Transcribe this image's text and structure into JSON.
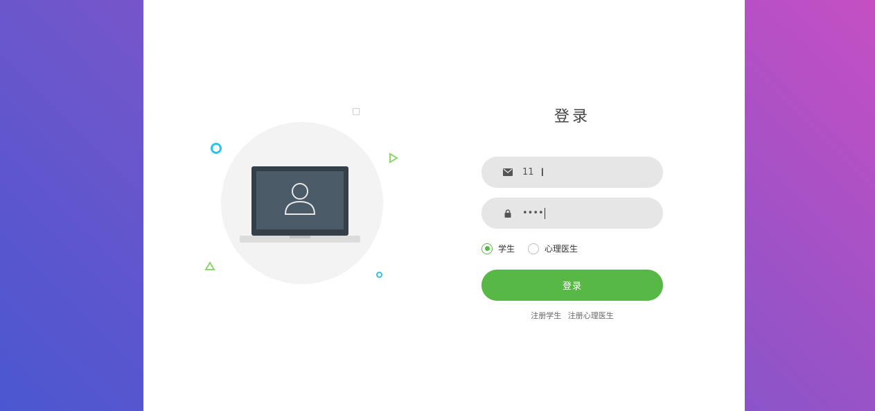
{
  "login": {
    "title": "登录",
    "email_field": {
      "value": "11",
      "icon": "envelope-icon"
    },
    "password_field": {
      "value": "••••",
      "icon": "lock-icon"
    },
    "roles": [
      {
        "label": "学生",
        "checked": true
      },
      {
        "label": "心理医生",
        "checked": false
      }
    ],
    "login_button": "登录",
    "links": [
      "注册学生",
      "注册心理医生"
    ]
  },
  "colors": {
    "accent": "#57b846",
    "field_bg": "#e6e6e6",
    "card_bg": "#ffffff",
    "gradient_start": "#4a57d0",
    "gradient_end": "#c54fc3",
    "decor_cyan": "#2ec3e6",
    "decor_green": "#8ed46b"
  }
}
